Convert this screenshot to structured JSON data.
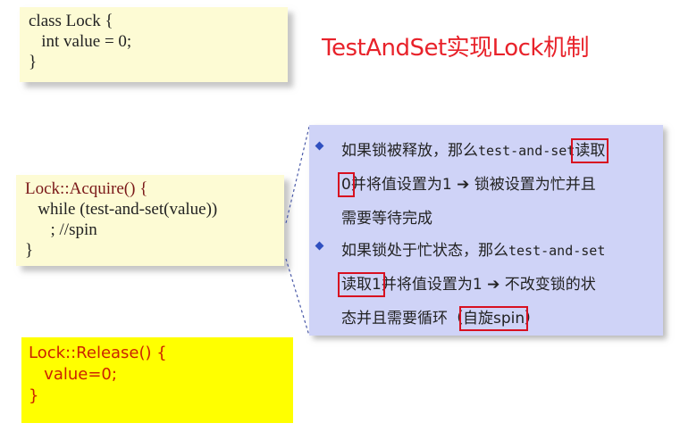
{
  "title": "TestAndSet实现Lock机制",
  "lock_class": {
    "lines": [
      "class Lock {",
      "   int value = 0;",
      "}"
    ]
  },
  "acquire": {
    "lines": [
      "Lock::Acquire() {",
      "   while (test-and-set(value))",
      "      ; //spin",
      "}"
    ]
  },
  "release": {
    "lines": [
      "Lock::Release() {",
      "   value=0;",
      "}"
    ]
  },
  "bullets": [
    {
      "line1_pre": "如果锁被释放，那么",
      "line1_mono": "test-and-set",
      "line1_hl": "读取",
      "line2_hl": "0",
      "line2_rest": "并将值设置为1",
      "arrow": "➔",
      "line2_after": "锁被设置为忙并且",
      "line3": "需要等待完成"
    },
    {
      "line1_pre": "如果锁处于忙状态，那么",
      "line1_mono": "test-and-set",
      "line2_hl": "读取1",
      "line2_rest": "并将值设置为1",
      "arrow": "➔",
      "line2_after": "不改变锁的状",
      "line3_pre": "态并且需要循环（",
      "line3_hl": "自旋spin",
      "line3_post": "）"
    }
  ],
  "colors": {
    "title": "#e8222a",
    "panel": "#cfd3f7",
    "highlight_box": "#d81020",
    "code_box": "#fdfbd4",
    "release_bg": "#ffff00"
  }
}
